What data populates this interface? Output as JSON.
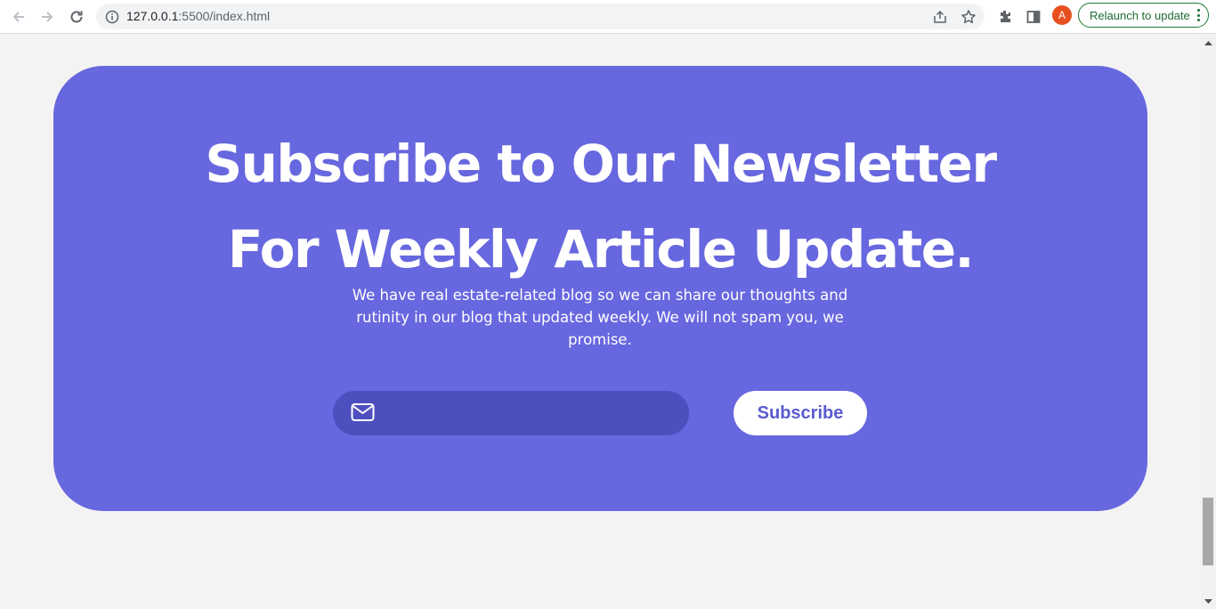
{
  "browser": {
    "url_host": "127.0.0.1",
    "url_rest": ":5500/index.html",
    "avatar_letter": "A",
    "relaunch_label": "Relaunch to update",
    "icons": [
      "back-icon",
      "forward-icon",
      "reload-icon",
      "info-icon",
      "share-icon",
      "star-icon",
      "extensions-icon",
      "side-panel-icon",
      "more-icon"
    ]
  },
  "newsletter": {
    "title_line1": "Subscribe to Our Newsletter",
    "title_line2": "For Weekly Article Update.",
    "description": "We have real estate-related blog so we can share our thoughts and rutinity in our blog that updated weekly. We will not spam you, we promise.",
    "email_placeholder": "",
    "subscribe_label": "Subscribe",
    "icon": "mail-icon"
  },
  "colors": {
    "card": "#6767df",
    "input": "#4e4fbf",
    "button_text": "#5a5ad0",
    "page": "#f3f3f3"
  }
}
